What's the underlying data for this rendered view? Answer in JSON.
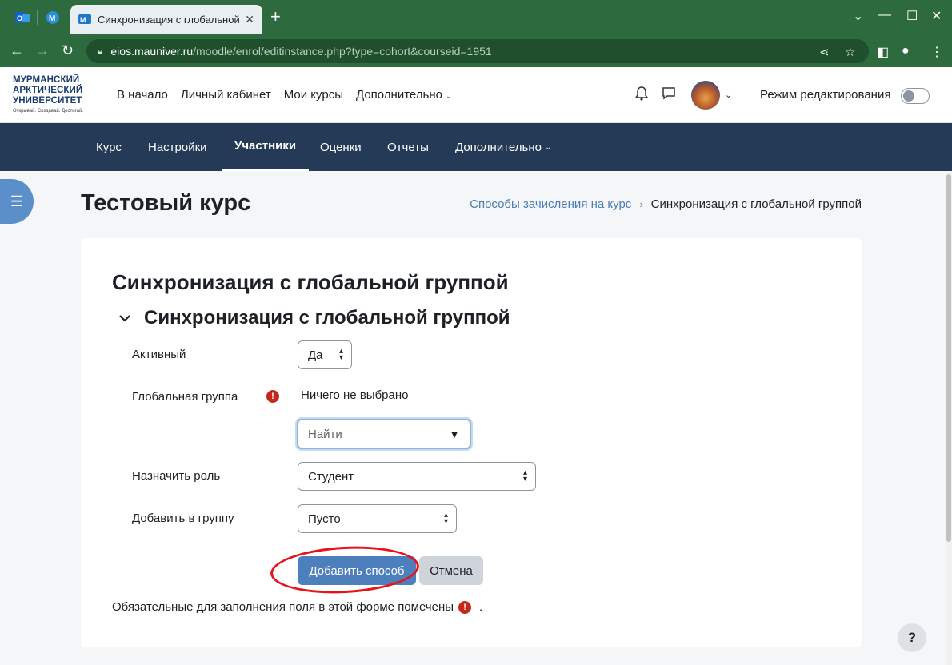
{
  "browser": {
    "tab_title": "Синхронизация с глобальной",
    "tab_close": "✕",
    "new_tab": "+",
    "url_host": "eios.mauniver.ru",
    "url_path": "/moodle/enrol/editinstance.php?type=cohort&courseid=1951",
    "win_min": "⌄",
    "win_minimize": "—",
    "win_max": "☐",
    "win_close": "✕"
  },
  "header": {
    "logo_lines": [
      "МУРМАНСКИЙ",
      "АРКТИЧЕСКИЙ",
      "УНИВЕРСИТЕТ"
    ],
    "logo_tagline": "Открывай. Создавай. Достигай.",
    "nav": [
      "В начало",
      "Личный кабинет",
      "Мои курсы",
      "Дополнительно"
    ],
    "edit_mode_label": "Режим редактирования",
    "edit_mode_on": false
  },
  "secondary_nav": {
    "items": [
      "Курс",
      "Настройки",
      "Участники",
      "Оценки",
      "Отчеты",
      "Дополнительно"
    ],
    "active": "Участники"
  },
  "page": {
    "course_title": "Тестовый курс",
    "breadcrumb_link": "Способы зачисления на курс",
    "breadcrumb_current": "Синхронизация с глобальной группой",
    "heading": "Синхронизация с глобальной группой",
    "section_heading": "Синхронизация с глобальной группой"
  },
  "form": {
    "active_label": "Активный",
    "active_value": "Да",
    "cohort_label": "Глобальная группа",
    "cohort_selection": "Ничего не выбрано",
    "cohort_search_placeholder": "Найти",
    "role_label": "Назначить роль",
    "role_value": "Студент",
    "group_label": "Добавить в группу",
    "group_value": "Пусто",
    "submit_label": "Добавить способ",
    "cancel_label": "Отмена",
    "required_note": "Обязательные для заполнения поля в этой форме помечены",
    "required_note_end": "."
  },
  "help": "?",
  "colors": {
    "browser_green": "#2d6b3f",
    "secondary_nav": "#253a56",
    "primary": "#4d7fbd",
    "required": "#c4281c",
    "annotation": "#e8121a"
  }
}
